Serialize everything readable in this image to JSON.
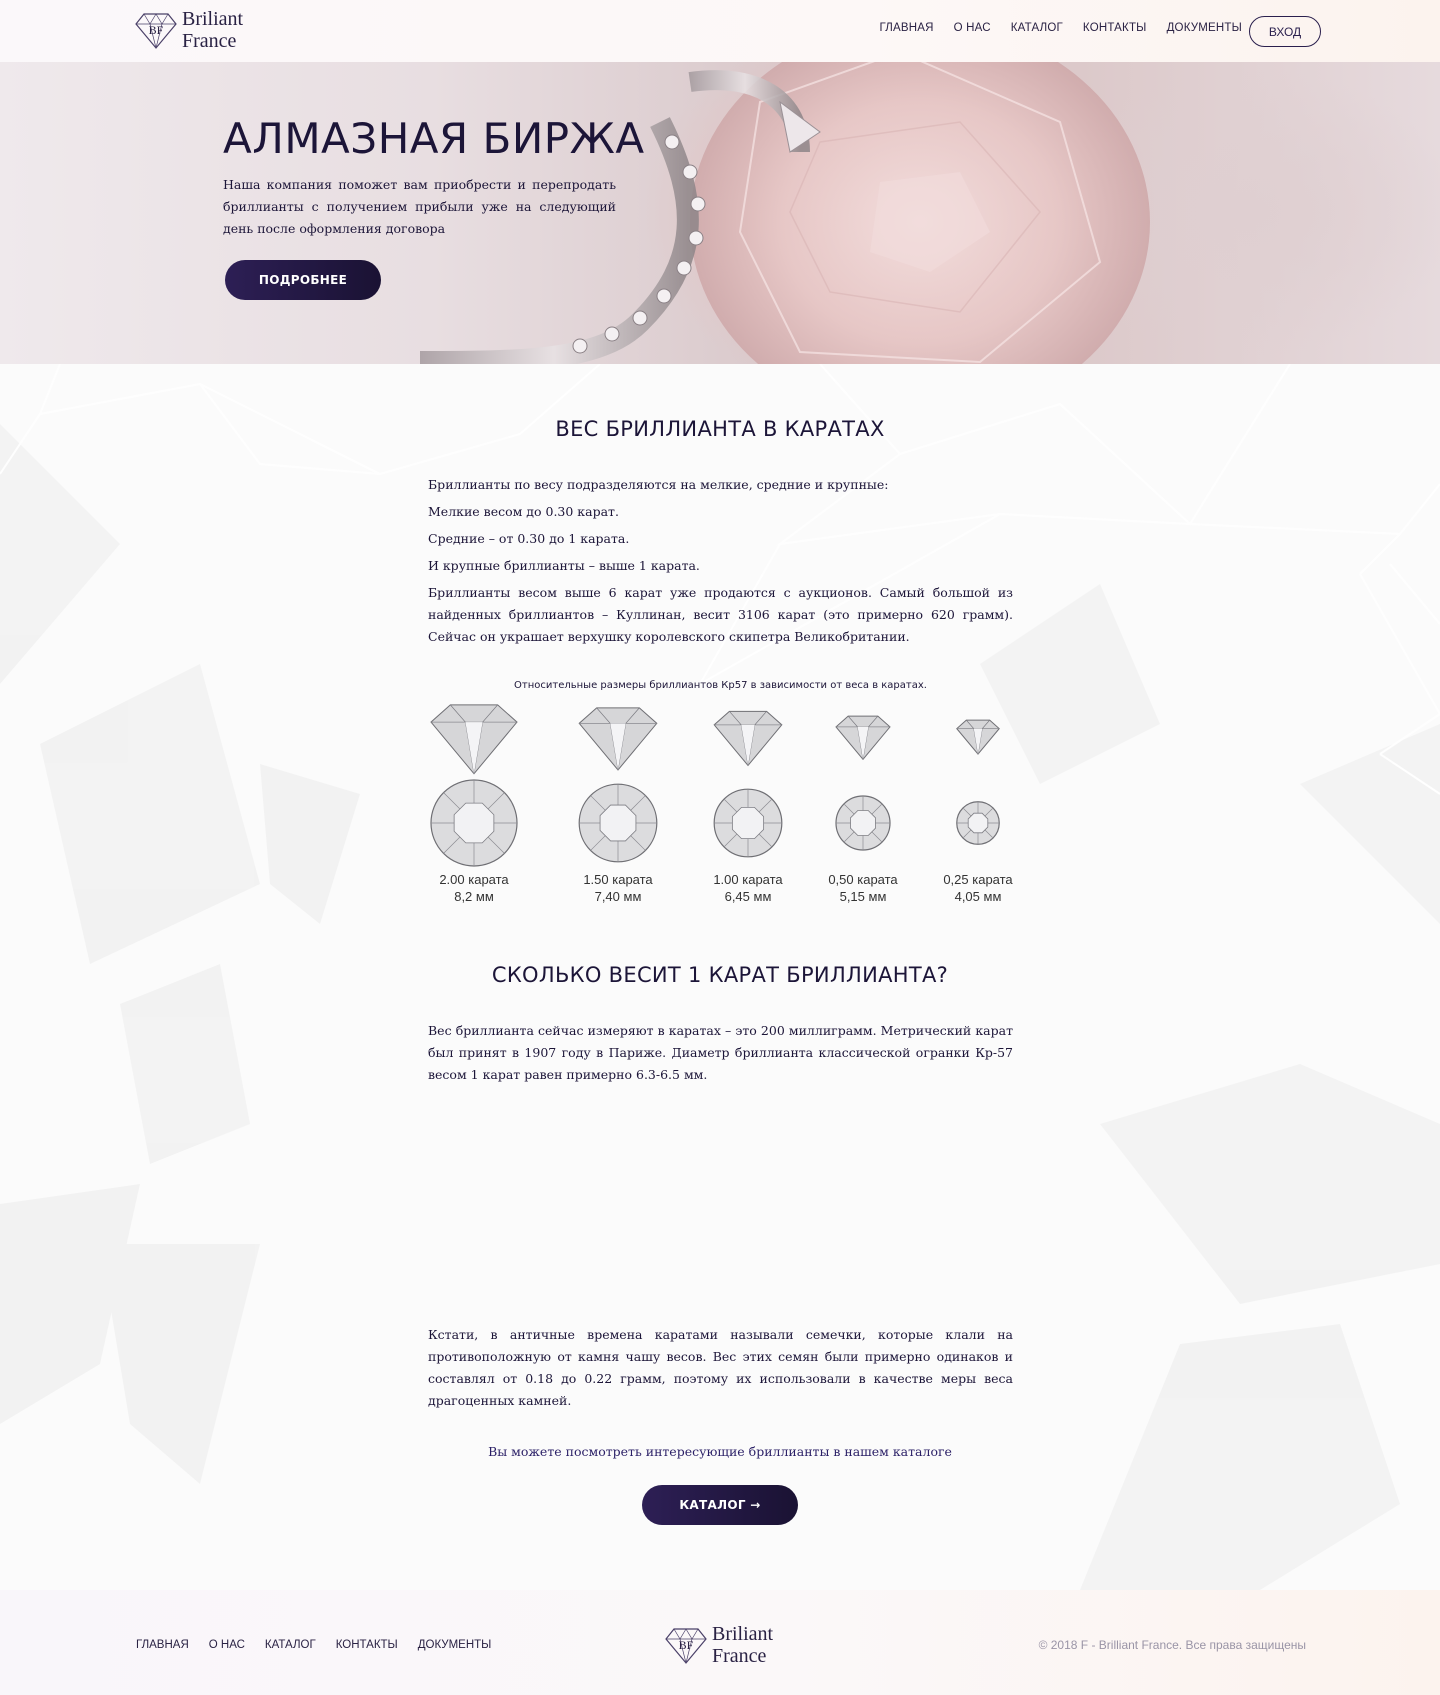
{
  "brand": {
    "initials": "BF",
    "line1": "Briliant",
    "line2": "France"
  },
  "nav": {
    "items": [
      {
        "label": "ГЛАВНАЯ"
      },
      {
        "label": "О НАС"
      },
      {
        "label": "КАТАЛОГ"
      },
      {
        "label": "КОНТАКТЫ"
      },
      {
        "label": "ДОКУМЕНТЫ"
      }
    ],
    "login_label": "ВХОД"
  },
  "hero": {
    "title": "АЛМАЗНАЯ БИРЖА",
    "text": "Наша компания поможет вам приобрести и перепродать бриллианты с получением прибыли уже на следующий день после оформления договора",
    "button_label": "ПОДРОБНЕЕ"
  },
  "section1": {
    "title": "ВЕС БРИЛЛИАНТА В КАРАТАХ",
    "lines": [
      "Бриллианты по весу подразделяются на мелкие, средние и крупные:",
      "Мелкие весом до 0.30 карат.",
      "Средние – от 0.30 до 1 карата.",
      "И крупные бриллианты – выше 1 карата."
    ],
    "paragraph": "Бриллианты весом выше 6 карат уже продаются с аукционов. Самый большой из найденных бриллиантов – Куллинан, весит 3106 карат (это примерно 620 грамм). Сейчас он украшает верхушку королевского скипетра Великобритании.",
    "caption": "Относительные размеры бриллиантов Кр57 в зависимости от веса в каратах.",
    "diamonds": [
      {
        "weight": "2.00 карата",
        "size": "8,2 мм",
        "carats": 2.0,
        "mm": 8.2
      },
      {
        "weight": "1.50 карата",
        "size": "7,40 мм",
        "carats": 1.5,
        "mm": 7.4
      },
      {
        "weight": "1.00 карата",
        "size": "6,45 мм",
        "carats": 1.0,
        "mm": 6.45
      },
      {
        "weight": "0,50 карата",
        "size": "5,15 мм",
        "carats": 0.5,
        "mm": 5.15
      },
      {
        "weight": "0,25 карата",
        "size": "4,05 мм",
        "carats": 0.25,
        "mm": 4.05
      }
    ]
  },
  "section2": {
    "title": "СКОЛЬКО ВЕСИТ 1 КАРАТ БРИЛЛИАНТА?",
    "paragraph1": "Вес бриллианта сейчас измеряют в каратах – это 200 миллиграмм. Метрический карат был принят в 1907 году в Париже. Диаметр бриллианта классической огранки Кр-57 весом 1 карат равен примерно 6.3-6.5 мм.",
    "paragraph2": "Кстати, в античные времена каратами называли семечки, которые клали на противоположную от камня чашу весов. Вес этих семян были примерно одинаков и составлял от 0.18 до 0.22 грамм, поэтому их использовали в качестве меры веса драгоценных камней.",
    "catalog_note": "Вы можете посмотреть интересующие бриллианты в нашем каталоге",
    "catalog_button": "КАТАЛОГ →"
  },
  "footer": {
    "nav": [
      {
        "label": "ГЛАВНАЯ"
      },
      {
        "label": "О НАС"
      },
      {
        "label": "КАТАЛОГ"
      },
      {
        "label": "КОНТАКТЫ"
      },
      {
        "label": "ДОКУМЕНТЫ"
      }
    ],
    "copyright": "© 2018 F - Brilliant France. Все права защищены"
  },
  "colors": {
    "accent_dark": "#2d1f55",
    "text": "#1c1538",
    "muted": "#9a94a6"
  }
}
